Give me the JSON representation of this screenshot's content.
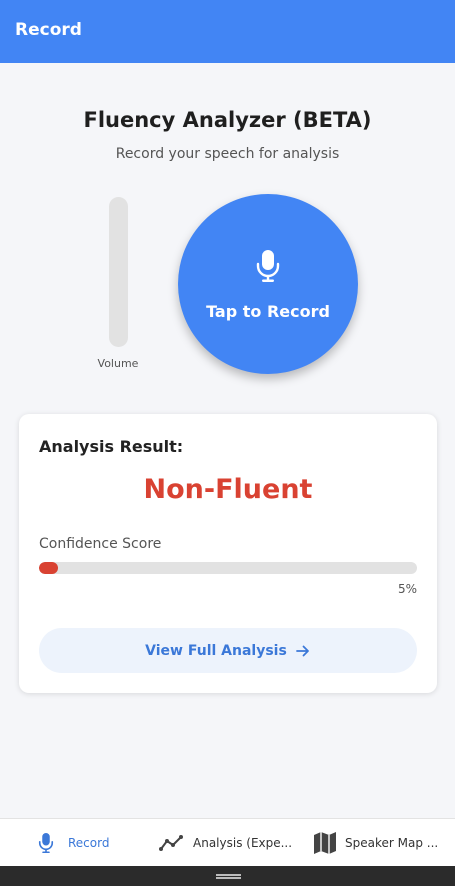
{
  "appbar": {
    "title": "Record"
  },
  "main": {
    "heading": "Fluency Analyzer (BETA)",
    "subheading": "Record your speech for analysis",
    "volume": {
      "label": "Volume",
      "level": 0
    },
    "record_button": {
      "label": "Tap to Record",
      "icon": "mic-icon"
    }
  },
  "result_card": {
    "title": "Analysis Result:",
    "result": "Non-Fluent",
    "confidence_label": "Confidence Score",
    "confidence_value": 5,
    "confidence_text": "5%",
    "view_button": {
      "label": "View Full Analysis",
      "icon": "arrow-right-icon"
    }
  },
  "bottom_nav": {
    "items": [
      {
        "label": "Record",
        "icon": "mic-icon",
        "active": true
      },
      {
        "label": "Analysis (Expe...",
        "icon": "line-chart-icon",
        "active": false
      },
      {
        "label": "Speaker Map ...",
        "icon": "map-icon",
        "active": false
      }
    ]
  },
  "colors": {
    "primary": "#4285f4",
    "accent_text": "#3b78d8",
    "danger": "#d94232",
    "track": "#e2e2e2",
    "background": "#f5f6f9"
  }
}
